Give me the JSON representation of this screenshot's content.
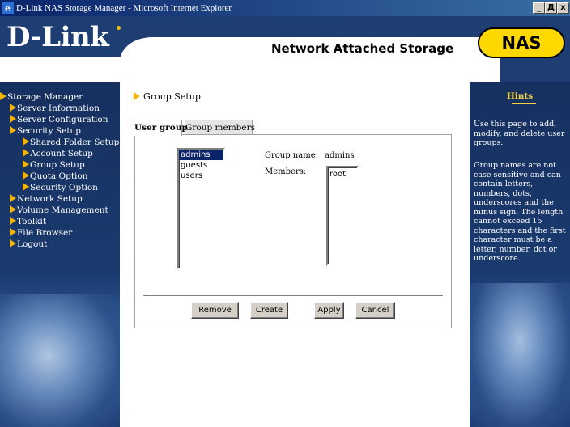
{
  "window": {
    "title": "D-Link NAS Storage Manager - Microsoft Internet Explorer",
    "buttons": [
      "_",
      "Д",
      "x"
    ]
  },
  "header": {
    "logo": "D-Link",
    "title": "Network Attached Storage",
    "badge": "NAS"
  },
  "sidebar": {
    "items": [
      {
        "label": "Storage Manager",
        "level": 0
      },
      {
        "label": "Server Information",
        "level": 1
      },
      {
        "label": "Server Configuration",
        "level": 1
      },
      {
        "label": "Security Setup",
        "level": 1
      },
      {
        "label": "Shared Folder Setup",
        "level": 2
      },
      {
        "label": "Account Setup",
        "level": 2
      },
      {
        "label": "Group Setup",
        "level": 2
      },
      {
        "label": "Quota Option",
        "level": 2
      },
      {
        "label": "Security Option",
        "level": 2
      },
      {
        "label": "Network Setup",
        "level": 1
      },
      {
        "label": "Volume Management",
        "level": 1
      },
      {
        "label": "Toolkit",
        "level": 1
      },
      {
        "label": "File Browser",
        "level": 1
      },
      {
        "label": "Logout",
        "level": 1
      }
    ]
  },
  "main": {
    "page_title": "Group Setup",
    "tabs": [
      {
        "label": "User group",
        "active": true
      },
      {
        "label": "Group members",
        "active": false
      }
    ],
    "groups": [
      "admins",
      "guests",
      "users"
    ],
    "selected_group": "admins",
    "group_name_label": "Group name:",
    "group_name_value": "admins",
    "members_label": "Members:",
    "members": [
      "root"
    ],
    "buttons": {
      "remove": "Remove",
      "create": "Create",
      "apply": "Apply",
      "cancel": "Cancel"
    }
  },
  "hints": {
    "title": "Hints",
    "paragraphs": [
      "Use this page to add, modify, and delete user groups.",
      "Group names are not case sensitive and can contain letters, numbers, dots, underscores and the minus sign. The length cannot exceed 15 characters and the first character must be a letter, number, dot or underscore."
    ]
  },
  "colors": {
    "navy": "#1e3d73",
    "accent_yellow": "#ffd800",
    "arrow_orange": "#f4b400",
    "selection": "#0a246a"
  }
}
